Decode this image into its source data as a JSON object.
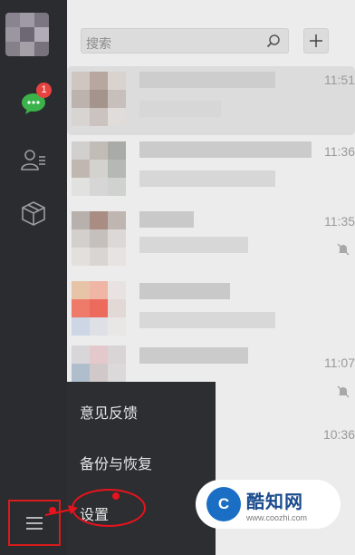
{
  "sidebar": {
    "badge_count": "1",
    "icons": [
      "chat-icon",
      "contacts-icon",
      "favorites-icon",
      "menu-icon"
    ]
  },
  "search": {
    "placeholder": "搜索"
  },
  "add_button_label": "+",
  "chats": [
    {
      "time": "11:51",
      "muted": false
    },
    {
      "time": "11:36",
      "muted": false
    },
    {
      "time": "11:35",
      "muted": true
    },
    {
      "time": "",
      "muted": false
    },
    {
      "time": "11:07",
      "muted": true
    },
    {
      "time": "10:36",
      "muted": false
    }
  ],
  "menu": {
    "items": [
      {
        "label": "意见反馈"
      },
      {
        "label": "备份与恢复"
      },
      {
        "label": "设置"
      }
    ]
  },
  "watermark": {
    "name": "酷知网",
    "url": "www.coozhi.com"
  },
  "colors": {
    "sidebar_bg": "#2a2c30",
    "accent_red": "#e8131c",
    "badge": "#e64340",
    "wechat_green": "#3bb34a"
  }
}
